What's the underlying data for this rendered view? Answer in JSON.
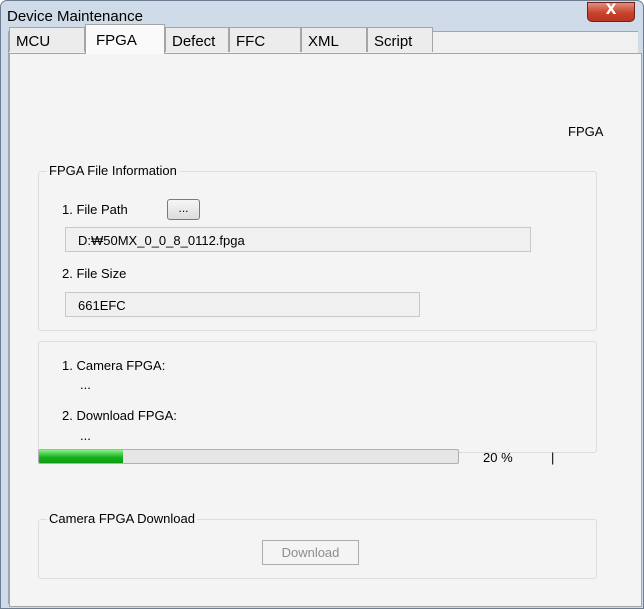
{
  "window": {
    "title": "Device Maintenance",
    "close_glyph": "X"
  },
  "tabs": [
    "MCU",
    "FPGA",
    "Defect",
    "FFC",
    "XML",
    "Script"
  ],
  "active_tab": "FPGA",
  "panel": {
    "header_label": "FPGA",
    "file_info": {
      "title": "FPGA File Information",
      "path_label": "1. File Path",
      "browse_label": "...",
      "path_value": "D:₩50MX_0_0_8_0112.fpga",
      "size_label": "2. File Size",
      "size_value": "661EFC"
    },
    "versions": {
      "camera_label": "1. Camera FPGA:",
      "camera_value": "...",
      "download_label": "2. Download FPGA:",
      "download_value": "..."
    },
    "progress": {
      "percent": 20,
      "percent_text": "20 %",
      "cursor_text": "|",
      "fill_color": "#19b31e"
    },
    "download_group": {
      "title": "Camera FPGA Download",
      "button_label": "Download"
    }
  },
  "icons": {
    "close": "close-icon"
  }
}
